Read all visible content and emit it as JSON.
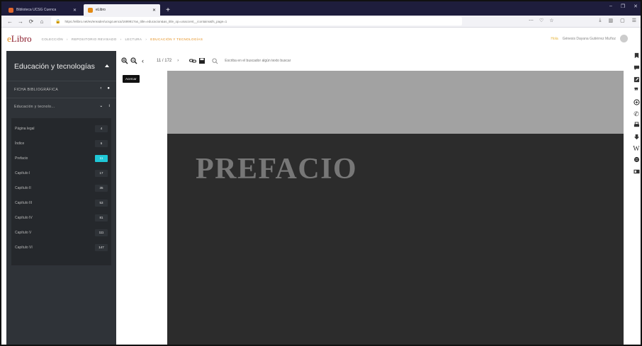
{
  "browser": {
    "tabs": [
      {
        "title": "Biblioteca UCSG Cuenca",
        "favicon_color": "#e0662b"
      },
      {
        "title": "eLibro",
        "favicon_color": "#e38a13"
      }
    ],
    "new_tab": "+",
    "window_controls": [
      "–",
      "❐",
      "✕"
    ],
    "nav": {
      "back": "←",
      "forward": "→",
      "reload": "⟳",
      "home": "⌂"
    },
    "url": "https://elibro.net/es/ereader/ucsgcuenca/169991?as_title=educacion&as_title_op=unaccent__icontains&fs_page=1",
    "url_icons": [
      "⋯",
      "♡",
      "☆"
    ],
    "toolbar_icons": [
      "⤓",
      "▥",
      "▢",
      "☰"
    ]
  },
  "app": {
    "logo_e": "e",
    "logo_rest": "Libro",
    "breadcrumbs": [
      "COLECCIÓN",
      "›",
      "REPOSITORIO REVISADO",
      "›",
      "LECTURA",
      "›"
    ],
    "breadcrumb_current": "EDUCACIÓN Y TECNOLOGÍAS",
    "user_prefix": "Hola",
    "user_name": "Génesis Dayana Gutiérrez Muñoz"
  },
  "sidebar": {
    "title": "Educación y tecnologías",
    "ficha_label": "FICHA BIBLIOGRÁFICA",
    "section_label": "Educación y tecnolo...",
    "toc": [
      {
        "label": "Página legal",
        "page": "4"
      },
      {
        "label": "Índice",
        "page": "6"
      },
      {
        "label": "Prefacio",
        "page": "11",
        "active": true
      },
      {
        "label": "Capítulo I",
        "page": "17"
      },
      {
        "label": "Capítulo II",
        "page": "35"
      },
      {
        "label": "Capítulo III",
        "page": "53"
      },
      {
        "label": "Capítulo IV",
        "page": "81"
      },
      {
        "label": "Capítulo V",
        "page": "111"
      },
      {
        "label": "Capítulo VI",
        "page": "147"
      }
    ]
  },
  "viewer": {
    "page_indicator": "11 / 172",
    "search_placeholder": "Escriba en el buscador algún texto buscar",
    "tooltip": "Acercar"
  },
  "document": {
    "heading": "PREFACIO"
  },
  "rail_icons": [
    "bookmark-icon",
    "comment-icon",
    "edit-icon",
    "quote-icon",
    "translate-icon",
    "cite-icon",
    "print-icon",
    "download-icon",
    "wikipedia-icon",
    "globe-icon",
    "id-card-icon"
  ],
  "colors": {
    "accent": "#1fc7d6",
    "brand": "#8b1d2c",
    "brand_e": "#e38a13"
  }
}
